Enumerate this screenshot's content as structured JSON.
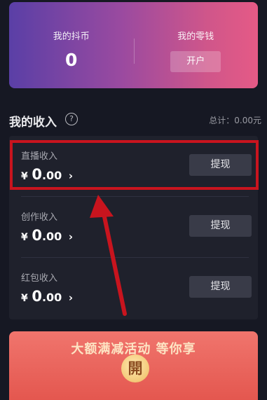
{
  "wallet": {
    "coins_label": "我的抖币",
    "coins_value": "0",
    "change_label": "我的零钱",
    "open_button": "开户"
  },
  "income": {
    "title": "我的收入",
    "help_icon": "question-circle-icon",
    "help_glyph": "?",
    "total": "总计：0.00元",
    "rows": [
      {
        "label": "直播收入",
        "currency": "¥",
        "int": "0",
        "dec": ".00",
        "chev": "›",
        "button": "提现"
      },
      {
        "label": "创作收入",
        "currency": "¥",
        "int": "0",
        "dec": ".00",
        "chev": "›",
        "button": "提现"
      },
      {
        "label": "红包收入",
        "currency": "¥",
        "int": "0",
        "dec": ".00",
        "chev": "›",
        "button": "提现"
      }
    ]
  },
  "promo": {
    "text": "大额满减活动 等你享",
    "coin": "開"
  },
  "colors": {
    "background": "#161823",
    "highlight": "#c8141e",
    "arrow": "#c8141e",
    "promo": "#e4574f"
  }
}
